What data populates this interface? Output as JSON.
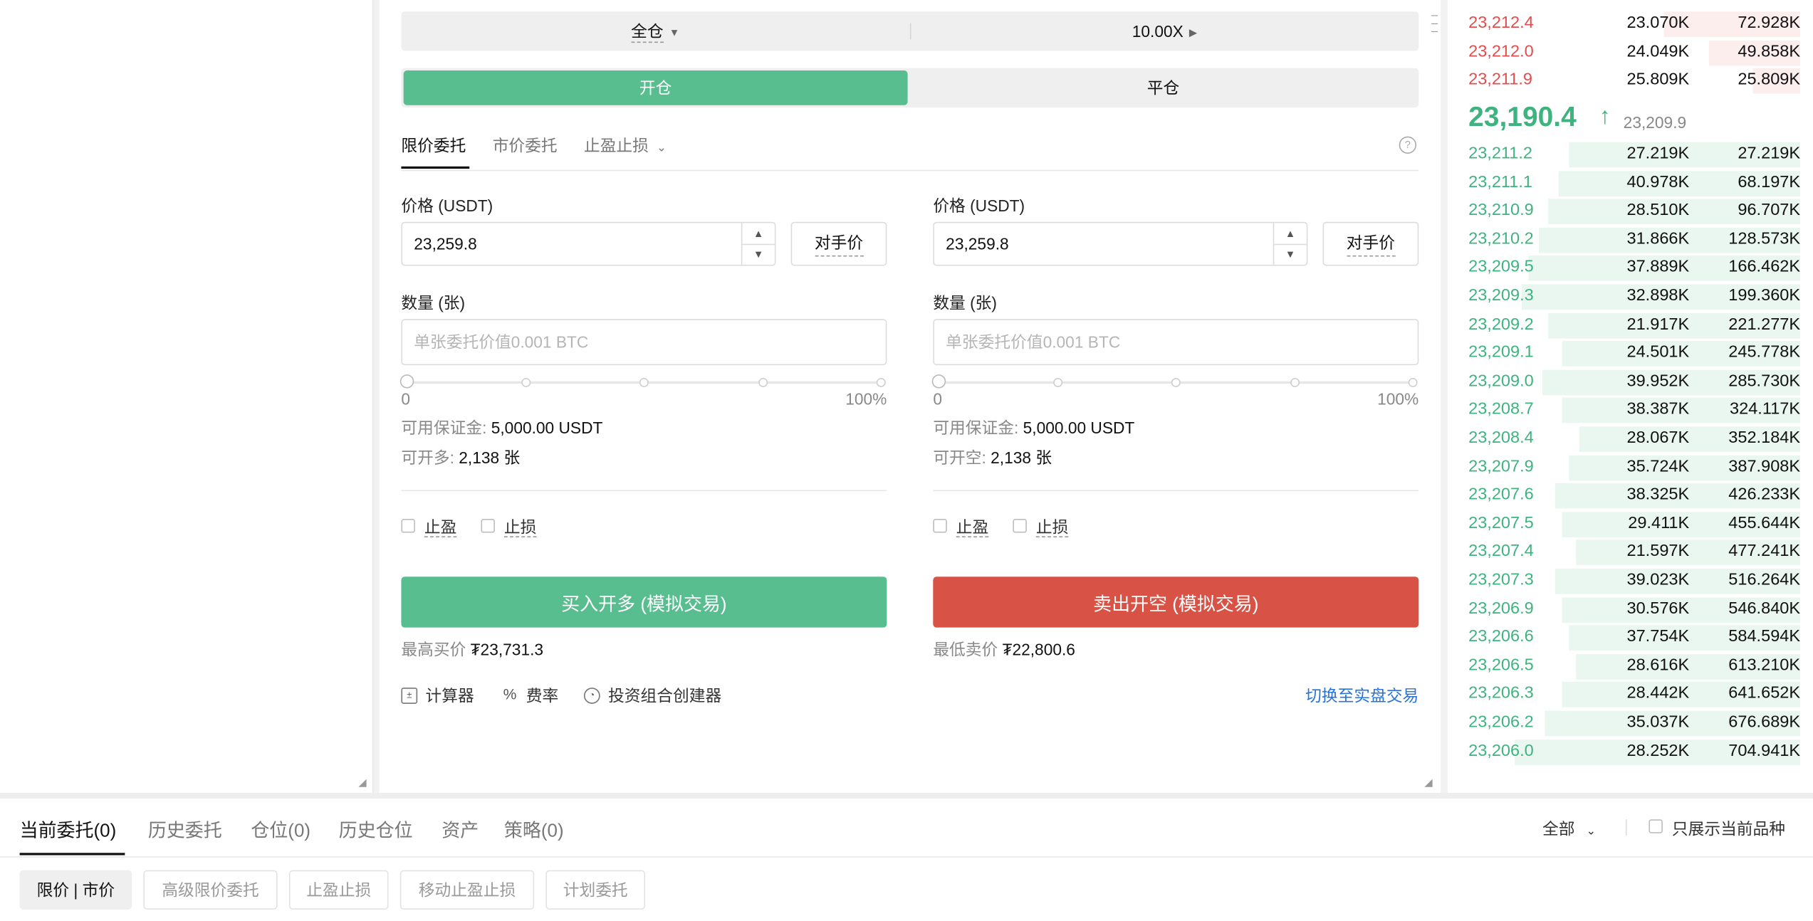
{
  "trade": {
    "margin_mode": "全仓",
    "leverage": "10.00X",
    "open_label": "开仓",
    "close_label": "平仓",
    "order_tabs": [
      "限价委托",
      "市价委托",
      "止盈止损"
    ],
    "help_glyph": "?",
    "buy": {
      "price_label": "价格 (USDT)",
      "price_value": "23,259.8",
      "counter_price": "对手价",
      "qty_label": "数量 (张)",
      "qty_placeholder": "单张委托价值0.001 BTC",
      "slider_min": "0",
      "slider_max": "100%",
      "slider_value_percent": 0,
      "margin_label": "可用保证金:",
      "margin_value": "5,000.00 USDT",
      "avail_label": "可开多:",
      "avail_value": "2,138 张",
      "take_profit": "止盈",
      "stop_loss": "止损",
      "submit": "买入开多 (模拟交易)",
      "limit_label": "最高买价",
      "limit_value": "₮23,731.3"
    },
    "sell": {
      "price_label": "价格 (USDT)",
      "price_value": "23,259.8",
      "counter_price": "对手价",
      "qty_label": "数量 (张)",
      "qty_placeholder": "单张委托价值0.001 BTC",
      "slider_min": "0",
      "slider_max": "100%",
      "slider_value_percent": 0,
      "margin_label": "可用保证金:",
      "margin_value": "5,000.00 USDT",
      "avail_label": "可开空:",
      "avail_value": "2,138 张",
      "take_profit": "止盈",
      "stop_loss": "止损",
      "submit": "卖出开空 (模拟交易)",
      "limit_label": "最低卖价",
      "limit_value": "₮22,800.6"
    },
    "tools": [
      "计算器",
      "费率",
      "投资组合创建器"
    ],
    "switch_link": "切换至实盘交易"
  },
  "orderbook": {
    "asks": [
      {
        "price": "23,212.4",
        "size": "23.070K",
        "total": "72.928K",
        "depth": 0.4
      },
      {
        "price": "23,212.0",
        "size": "24.049K",
        "total": "49.858K",
        "depth": 0.27
      },
      {
        "price": "23,211.9",
        "size": "25.809K",
        "total": "25.809K",
        "depth": 0.14
      }
    ],
    "last_price": "23,190.4",
    "last_arrow": "↑",
    "mark_price": "23,209.9",
    "bids": [
      {
        "price": "23,211.2",
        "size": "27.219K",
        "total": "27.219K",
        "depth": 0.68
      },
      {
        "price": "23,211.1",
        "size": "40.978K",
        "total": "68.197K",
        "depth": 0.71
      },
      {
        "price": "23,210.9",
        "size": "28.510K",
        "total": "96.707K",
        "depth": 0.74
      },
      {
        "price": "23,210.2",
        "size": "31.866K",
        "total": "128.573K",
        "depth": 0.77
      },
      {
        "price": "23,209.5",
        "size": "37.889K",
        "total": "166.462K",
        "depth": 0.8
      },
      {
        "price": "23,209.3",
        "size": "32.898K",
        "total": "199.360K",
        "depth": 0.82
      },
      {
        "price": "23,209.2",
        "size": "21.917K",
        "total": "221.277K",
        "depth": 0.74
      },
      {
        "price": "23,209.1",
        "size": "24.501K",
        "total": "245.778K",
        "depth": 0.7
      },
      {
        "price": "23,209.0",
        "size": "39.952K",
        "total": "285.730K",
        "depth": 0.76
      },
      {
        "price": "23,208.7",
        "size": "38.387K",
        "total": "324.117K",
        "depth": 0.7
      },
      {
        "price": "23,208.4",
        "size": "28.067K",
        "total": "352.184K",
        "depth": 0.65
      },
      {
        "price": "23,207.9",
        "size": "35.724K",
        "total": "387.908K",
        "depth": 0.68
      },
      {
        "price": "23,207.6",
        "size": "38.325K",
        "total": "426.233K",
        "depth": 0.72
      },
      {
        "price": "23,207.5",
        "size": "29.411K",
        "total": "455.644K",
        "depth": 0.7
      },
      {
        "price": "23,207.4",
        "size": "21.597K",
        "total": "477.241K",
        "depth": 0.66
      },
      {
        "price": "23,207.3",
        "size": "39.023K",
        "total": "516.264K",
        "depth": 0.72
      },
      {
        "price": "23,206.9",
        "size": "30.576K",
        "total": "546.840K",
        "depth": 0.7
      },
      {
        "price": "23,206.6",
        "size": "37.754K",
        "total": "584.594K",
        "depth": 0.68
      },
      {
        "price": "23,206.5",
        "size": "28.616K",
        "total": "613.210K",
        "depth": 0.66
      },
      {
        "price": "23,206.3",
        "size": "28.442K",
        "total": "641.652K",
        "depth": 0.7
      },
      {
        "price": "23,206.2",
        "size": "35.037K",
        "total": "676.689K",
        "depth": 0.75
      },
      {
        "price": "23,206.0",
        "size": "28.252K",
        "total": "704.941K",
        "depth": 0.84
      }
    ]
  },
  "bottom": {
    "tabs": [
      "当前委托(0)",
      "历史委托",
      "仓位(0)",
      "历史仓位",
      "资产",
      "策略(0)"
    ],
    "filter_all": "全部",
    "only_current": "只展示当前品种",
    "sub_tabs": [
      "限价 | 市价",
      "高级限价委托",
      "止盈止损",
      "移动止盈止损",
      "计划委托"
    ]
  },
  "colors": {
    "buy_green": "#58be8f",
    "sell_red": "#d85345",
    "bid_green_text": "#3fb37f",
    "ask_red_text": "#e24d4d",
    "link_blue": "#2a73d6"
  }
}
